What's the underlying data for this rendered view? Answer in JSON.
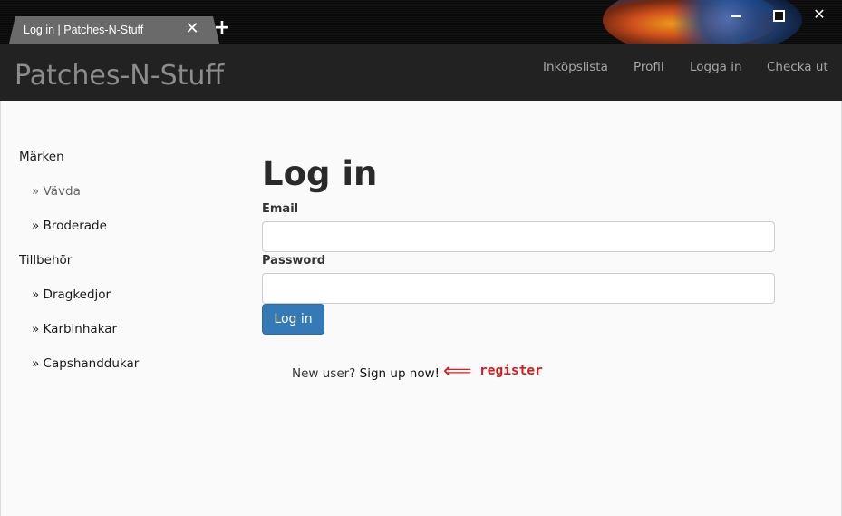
{
  "browser": {
    "tab_title": "Log in | Patches-N-Stuff",
    "tab_close_glyph": "✕",
    "new_tab_glyph": "+",
    "close_glyph": "✕"
  },
  "navbar": {
    "brand": "Patches-N-Stuff",
    "links": [
      "Inköpslista",
      "Profil",
      "Logga in",
      "Checka ut"
    ]
  },
  "sidebar": {
    "items": [
      {
        "label": "Märken",
        "level": "category"
      },
      {
        "label": "» Vävda",
        "level": "sub",
        "muted": true
      },
      {
        "label": "» Broderade",
        "level": "sub"
      },
      {
        "label": "Tillbehör",
        "level": "category"
      },
      {
        "label": "» Dragkedjor",
        "level": "sub"
      },
      {
        "label": "» Karbinhakar",
        "level": "sub"
      },
      {
        "label": "» Capshanddukar",
        "level": "sub"
      }
    ]
  },
  "login": {
    "title": "Log in",
    "email_label": "Email",
    "email_value": "",
    "password_label": "Password",
    "password_value": "",
    "submit_label": "Log in",
    "new_user_text": "New user?",
    "signup_link": "Sign up now!"
  },
  "annotation": {
    "arrow": "⟸",
    "text": "register",
    "color": "#e01b1b"
  },
  "colors": {
    "navbar_bg": "#222222",
    "brand": "#8c8c8c",
    "nav_link": "#a6a6a6",
    "button_primary": "#337ab7",
    "page_bg": "#fafafa"
  }
}
